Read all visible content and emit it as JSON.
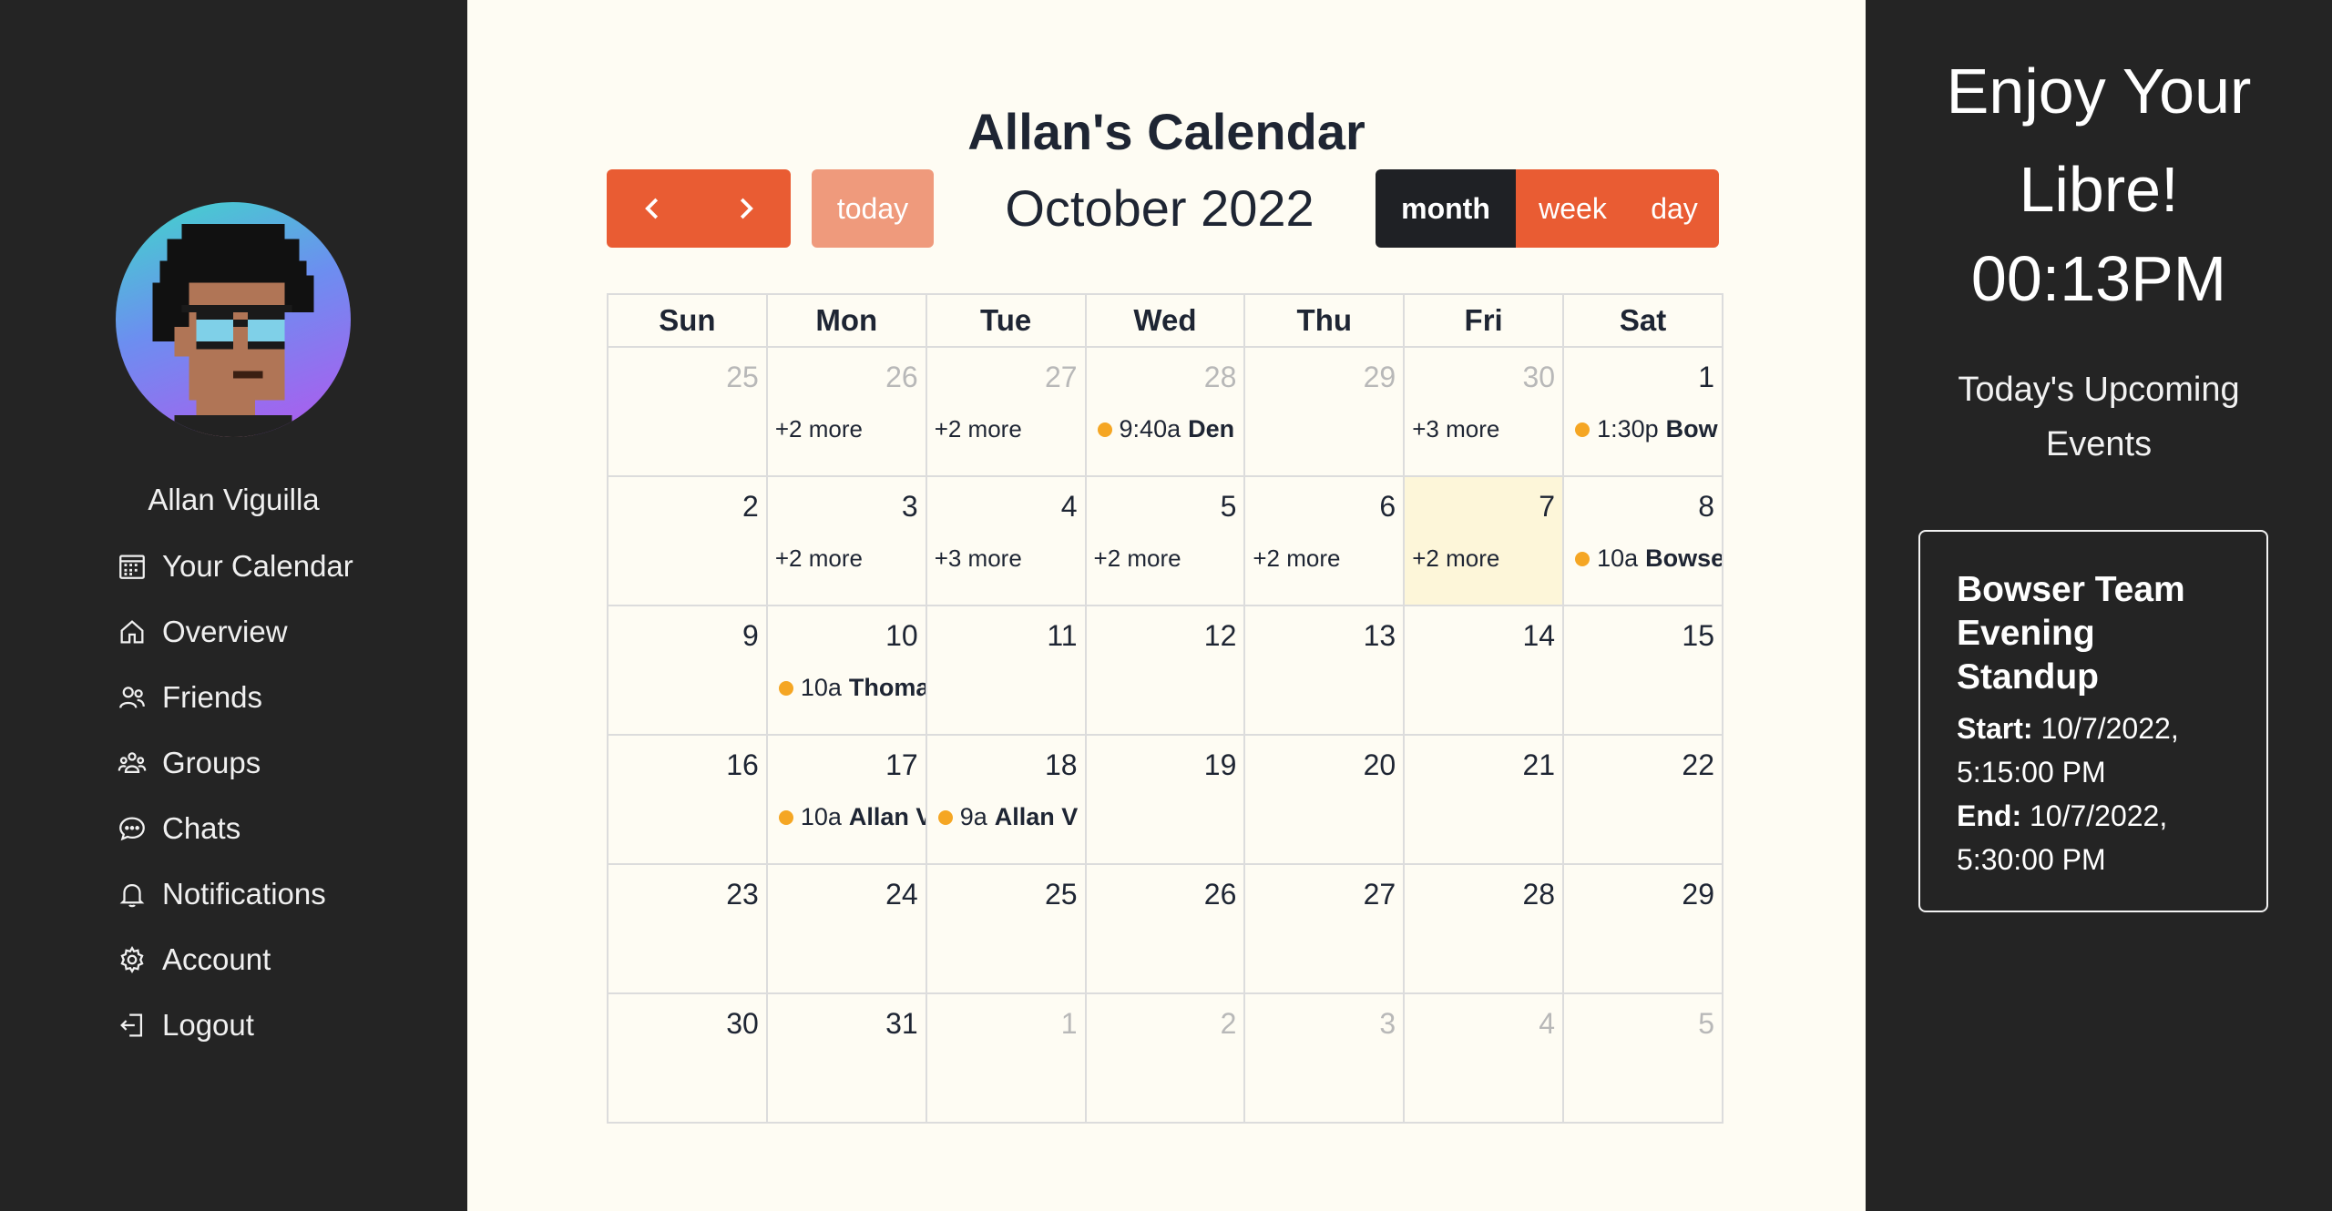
{
  "sidebar": {
    "user_name": "Allan Viguilla",
    "nav": [
      {
        "label": "Your Calendar",
        "icon": "calendar-icon"
      },
      {
        "label": "Overview",
        "icon": "home-icon"
      },
      {
        "label": "Friends",
        "icon": "users-icon"
      },
      {
        "label": "Groups",
        "icon": "groups-icon"
      },
      {
        "label": "Chats",
        "icon": "chat-icon"
      },
      {
        "label": "Notifications",
        "icon": "bell-icon"
      },
      {
        "label": "Account",
        "icon": "gear-icon"
      },
      {
        "label": "Logout",
        "icon": "logout-icon"
      }
    ]
  },
  "calendar": {
    "title": "Allan's Calendar",
    "month_label": "October 2022",
    "today_label": "today",
    "views": [
      "month",
      "week",
      "day"
    ],
    "active_view": "month",
    "weekdays": [
      "Sun",
      "Mon",
      "Tue",
      "Wed",
      "Thu",
      "Fri",
      "Sat"
    ],
    "weeks": [
      [
        {
          "day": "25",
          "other": true
        },
        {
          "day": "26",
          "other": true,
          "more": "+2 more"
        },
        {
          "day": "27",
          "other": true,
          "more": "+2 more"
        },
        {
          "day": "28",
          "other": true,
          "event": {
            "time": "9:40a",
            "title": "Den"
          }
        },
        {
          "day": "29",
          "other": true
        },
        {
          "day": "30",
          "other": true,
          "more": "+3 more"
        },
        {
          "day": "1",
          "event": {
            "time": "1:30p",
            "title": "Bow"
          }
        }
      ],
      [
        {
          "day": "2"
        },
        {
          "day": "3",
          "more": "+2 more"
        },
        {
          "day": "4",
          "more": "+3 more"
        },
        {
          "day": "5",
          "more": "+2 more"
        },
        {
          "day": "6",
          "more": "+2 more"
        },
        {
          "day": "7",
          "today": true,
          "more": "+2 more"
        },
        {
          "day": "8",
          "event": {
            "time": "10a",
            "title": "Bowse"
          }
        }
      ],
      [
        {
          "day": "9"
        },
        {
          "day": "10",
          "event": {
            "time": "10a",
            "title": "Thoma"
          }
        },
        {
          "day": "11"
        },
        {
          "day": "12"
        },
        {
          "day": "13"
        },
        {
          "day": "14"
        },
        {
          "day": "15"
        }
      ],
      [
        {
          "day": "16"
        },
        {
          "day": "17",
          "event": {
            "time": "10a",
            "title": "Allan V"
          }
        },
        {
          "day": "18",
          "event": {
            "time": "9a",
            "title": "Allan V"
          }
        },
        {
          "day": "19"
        },
        {
          "day": "20"
        },
        {
          "day": "21"
        },
        {
          "day": "22"
        }
      ],
      [
        {
          "day": "23"
        },
        {
          "day": "24"
        },
        {
          "day": "25"
        },
        {
          "day": "26"
        },
        {
          "day": "27"
        },
        {
          "day": "28"
        },
        {
          "day": "29"
        }
      ],
      [
        {
          "day": "30"
        },
        {
          "day": "31"
        },
        {
          "day": "1",
          "other": true
        },
        {
          "day": "2",
          "other": true
        },
        {
          "day": "3",
          "other": true
        },
        {
          "day": "4",
          "other": true
        },
        {
          "day": "5",
          "other": true
        }
      ]
    ]
  },
  "right_panel": {
    "greeting_line1": "Enjoy Your",
    "greeting_line2": "Libre!",
    "clock": "00:13PM",
    "upcoming_label": "Today's Upcoming Events",
    "event": {
      "title": "Bowser Team Evening Standup",
      "start_label": "Start:",
      "start_value": "10/7/2022, 5:15:00 PM",
      "end_label": "End:",
      "end_value": "10/7/2022, 5:30:00 PM"
    }
  },
  "colors": {
    "accent": "#e95c33",
    "accent_light": "#ef9a7c",
    "dark": "#242424",
    "event_dot": "#f5a623",
    "today_bg": "#fdf6d9"
  }
}
